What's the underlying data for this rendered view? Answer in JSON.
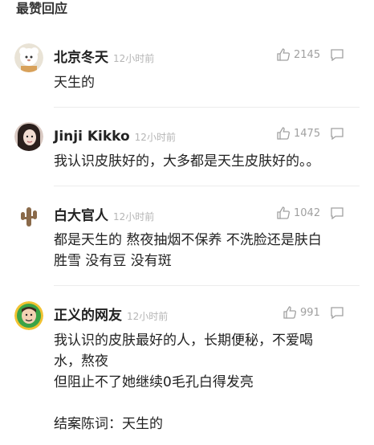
{
  "section_title": "最赞回应",
  "comments": [
    {
      "author": "北京冬天",
      "time": "12小时前",
      "likes": "2145",
      "lines": [
        "天生的"
      ]
    },
    {
      "author": "Jinji Kikko",
      "time": "12小时前",
      "likes": "1475",
      "lines": [
        "我认识皮肤好的，大多都是天生皮肤好的。。"
      ]
    },
    {
      "author": "白大官人",
      "time": "12小时前",
      "likes": "1042",
      "lines": [
        "都是天生的 熬夜抽烟不保养 不洗脸还是肤白",
        "胜雪 没有豆 没有斑"
      ]
    },
    {
      "author": "正义的网友",
      "time": "12小时前",
      "likes": "991",
      "lines": [
        "我认识的皮肤最好的人，长期便秘，不爱喝",
        "水，熬夜",
        "但阻止不了她继续0毛孔白得发亮",
        "",
        "结案陈词：天生的"
      ]
    }
  ],
  "icons": {
    "like": "thumbs-up-icon",
    "reply": "comment-bubble-icon"
  },
  "colors": {
    "text": "#222222",
    "muted": "#b5b5b5",
    "icon": "#a0a0a0",
    "divider": "#ececec"
  }
}
